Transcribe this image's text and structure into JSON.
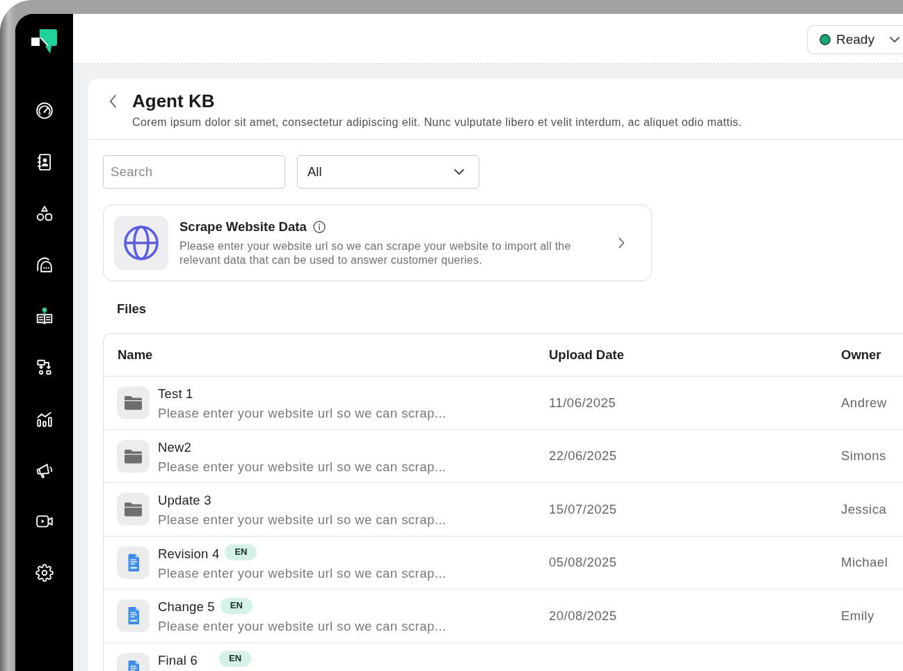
{
  "sidebar": {
    "items": [
      {
        "kind": "gauge",
        "selected": false
      },
      {
        "kind": "contacts",
        "selected": false
      },
      {
        "kind": "shapes",
        "selected": false
      },
      {
        "kind": "chat",
        "selected": false
      },
      {
        "kind": "knowledge",
        "selected": true
      },
      {
        "kind": "flow",
        "selected": false
      },
      {
        "kind": "analytics",
        "selected": false
      },
      {
        "kind": "megaphone",
        "selected": false
      },
      {
        "kind": "video",
        "selected": false
      },
      {
        "kind": "settings",
        "selected": false
      }
    ]
  },
  "top_bar": {
    "status": {
      "label": "Ready"
    }
  },
  "header": {
    "title": "Agent KB",
    "description": "Corem ipsum dolor sit amet, consectetur adipiscing elit. Nunc vulputate libero et velit interdum, ac aliquet odio mattis."
  },
  "filters": {
    "search": {
      "placeholder": "Search"
    },
    "type": {
      "value": "All"
    }
  },
  "scrape_card": {
    "title": "Scrape Website Data",
    "description": "Please enter your website url so we can scrape your website to import all the relevant data that can be used to answer customer queries."
  },
  "files": {
    "heading": "Files",
    "table": {
      "columns": [
        "Name",
        "Upload Date",
        "Owner"
      ],
      "rows": [
        {
          "kind": "folder",
          "name": "Test 1",
          "description": "Please enter your website url so we can scrap...",
          "upload_date": "11/06/2025",
          "owner": "Andrew"
        },
        {
          "kind": "folder",
          "name": "New2",
          "description": "Please enter your website url so we can scrap...",
          "upload_date": "22/06/2025",
          "owner": "Simons"
        },
        {
          "kind": "folder",
          "name": "Update 3",
          "description": "Please enter your website url so we can scrap...",
          "upload_date": "15/07/2025",
          "owner": "Jessica"
        },
        {
          "kind": "doc",
          "name": "Revision 4",
          "badge": "EN",
          "description": "Please enter your website url so we can scrap...",
          "upload_date": "05/08/2025",
          "owner": "Michael"
        },
        {
          "kind": "doc",
          "name": "Change 5",
          "badge": "EN",
          "description": "Please enter your website url so we can scrap...",
          "upload_date": "20/08/2025",
          "owner": "Emily"
        },
        {
          "kind": "doc",
          "name": "Final 6",
          "badge": "EN"
        }
      ]
    }
  }
}
